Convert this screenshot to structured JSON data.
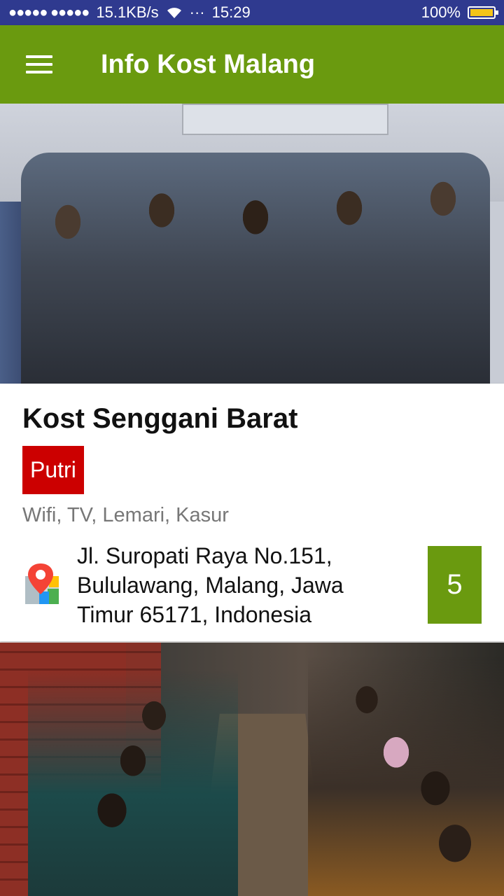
{
  "status_bar": {
    "signal": "●●●●● ●●●●●",
    "speed": "15.1KB/s",
    "more": "···",
    "time": "15:29",
    "battery": "100%"
  },
  "app_bar": {
    "title": "Info Kost Malang"
  },
  "listing": {
    "name": "Kost Senggani Barat",
    "gender": "Putri",
    "facilities": "Wifi,  TV,  Lemari,  Kasur",
    "address": "Jl. Suropati Raya No.151, Bululawang, Malang, Jawa Timur 65171, Indonesia",
    "room_count": "5"
  },
  "colors": {
    "status_bar": "#2f3a8f",
    "app_bar": "#6a9a0f",
    "gender_badge": "#cc0000",
    "room_badge": "#6a9a0f"
  }
}
